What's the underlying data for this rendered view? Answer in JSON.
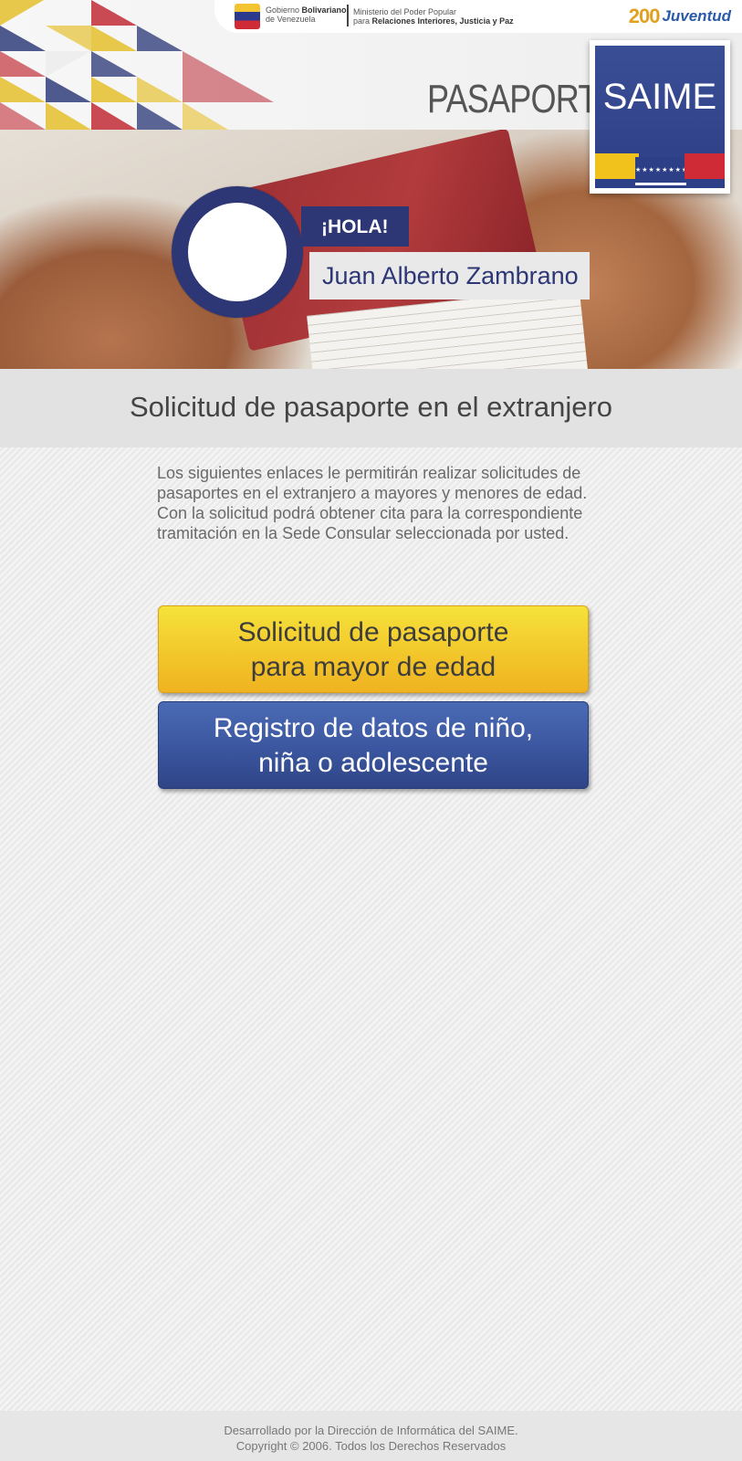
{
  "header": {
    "gov_line1_a": "Gobierno ",
    "gov_line1_b": "Bolivariano",
    "gov_line2": "de Venezuela",
    "ministry_line1": "Ministerio del Poder Popular",
    "ministry_line2_a": "para ",
    "ministry_line2_b": "Relaciones Interiores, Justicia y Paz",
    "juventud_number": "200",
    "juventud_word": "Juventud",
    "title": "PASAPORTE",
    "logo_text": "SAIME"
  },
  "greeting": {
    "hello": "¡HOLA!",
    "user_name": "Juan Alberto Zambrano"
  },
  "section": {
    "title": "Solicitud de pasaporte en el extranjero"
  },
  "intro": {
    "text": "Los siguientes enlaces le permitirán realizar solicitudes de pasaportes en el extranjero a mayores y menores de edad. Con la solicitud podrá obtener cita para la correspondiente tramitación en la Sede Consular seleccionada por usted."
  },
  "actions": {
    "adult_line1": "Solicitud de pasaporte",
    "adult_line2": "para mayor de edad",
    "minor_line1": "Registro de datos de niño,",
    "minor_line2": "niña o adolescente"
  },
  "footer": {
    "line1": "Desarrollado por la Dirección de Informática del SAIME.",
    "line2": "Copyright © 2006. Todos los Derechos Reservados"
  },
  "colors": {
    "brand_blue": "#2d3775",
    "button_yellow": "#f2c52a",
    "button_blue": "#3b569f",
    "flag_red": "#cf2b36"
  }
}
